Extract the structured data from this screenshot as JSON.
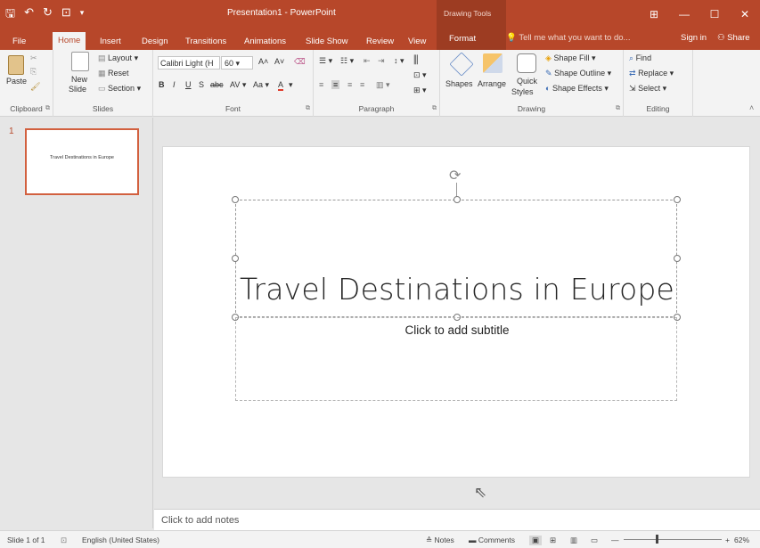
{
  "titlebar": {
    "title": "Presentation1 - PowerPoint",
    "context_group": "Drawing Tools"
  },
  "tabs": [
    {
      "label": "File"
    },
    {
      "label": "Home"
    },
    {
      "label": "Insert"
    },
    {
      "label": "Design"
    },
    {
      "label": "Transitions"
    },
    {
      "label": "Animations"
    },
    {
      "label": "Slide Show"
    },
    {
      "label": "Review"
    },
    {
      "label": "View"
    },
    {
      "label": "Format"
    }
  ],
  "tellme": "Tell me what you want to do...",
  "signin": "Sign in",
  "share": "Share",
  "ribbon": {
    "clipboard": {
      "paste": "Paste",
      "label": "Clipboard"
    },
    "slides": {
      "new_slide": "New",
      "new_slide2": "Slide",
      "layout": "Layout",
      "reset": "Reset",
      "section": "Section",
      "label": "Slides"
    },
    "font": {
      "font_name": "Calibri Light (H",
      "font_size": "60",
      "label": "Font"
    },
    "paragraph": {
      "label": "Paragraph"
    },
    "drawing": {
      "shapes": "Shapes",
      "arrange": "Arrange",
      "quick": "Quick",
      "styles": "Styles",
      "shape_fill": "Shape Fill",
      "shape_outline": "Shape Outline",
      "shape_effects": "Shape Effects",
      "label": "Drawing"
    },
    "editing": {
      "find": "Find",
      "replace": "Replace",
      "select": "Select",
      "label": "Editing"
    }
  },
  "thumbnail": {
    "number": "1",
    "text": "Travel Destinations in Europe"
  },
  "slide": {
    "title": "Travel Destinations in Europe",
    "subtitle_placeholder": "Click to add subtitle"
  },
  "notes_placeholder": "Click to add notes",
  "status": {
    "slide_count": "Slide 1 of 1",
    "language": "English (United States)",
    "notes": "Notes",
    "comments": "Comments",
    "zoom": "62%"
  }
}
